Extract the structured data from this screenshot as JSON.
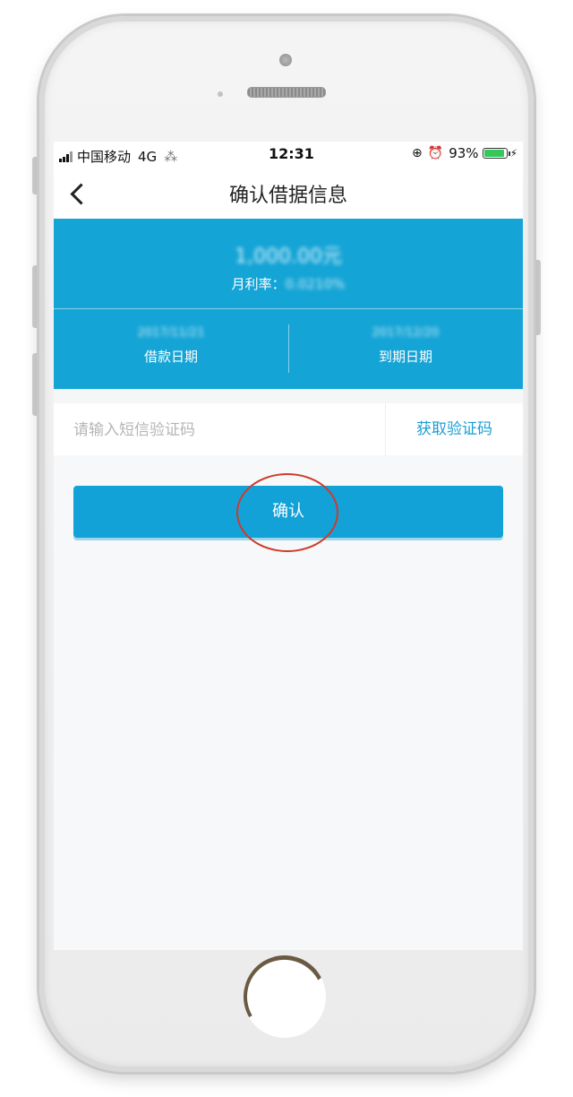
{
  "status_bar": {
    "carrier": "中国移动",
    "network": "4G",
    "time": "12:31",
    "battery_percent": "93%",
    "icons": [
      "signal-icon",
      "loading-icon",
      "lock-rotation-icon",
      "alarm-icon",
      "battery-icon",
      "charging-icon"
    ]
  },
  "navbar": {
    "back_icon": "chevron-left-icon",
    "title": "确认借据信息"
  },
  "loan_card": {
    "amount": "1,000.00元",
    "rate_label": "月利率：",
    "rate_value": "0.0210%",
    "loan_date_value": "2017/11/21",
    "loan_date_label": "借款日期",
    "due_date_value": "2017/12/20",
    "due_date_label": "到期日期"
  },
  "verification": {
    "placeholder": "请输入短信验证码",
    "get_code_label": "获取验证码"
  },
  "confirm_label": "确认",
  "colors": {
    "brand_blue": "#14a4d6",
    "link_blue": "#1a9fd4",
    "annotation_red": "#d03a2a",
    "battery_green": "#35c759"
  }
}
